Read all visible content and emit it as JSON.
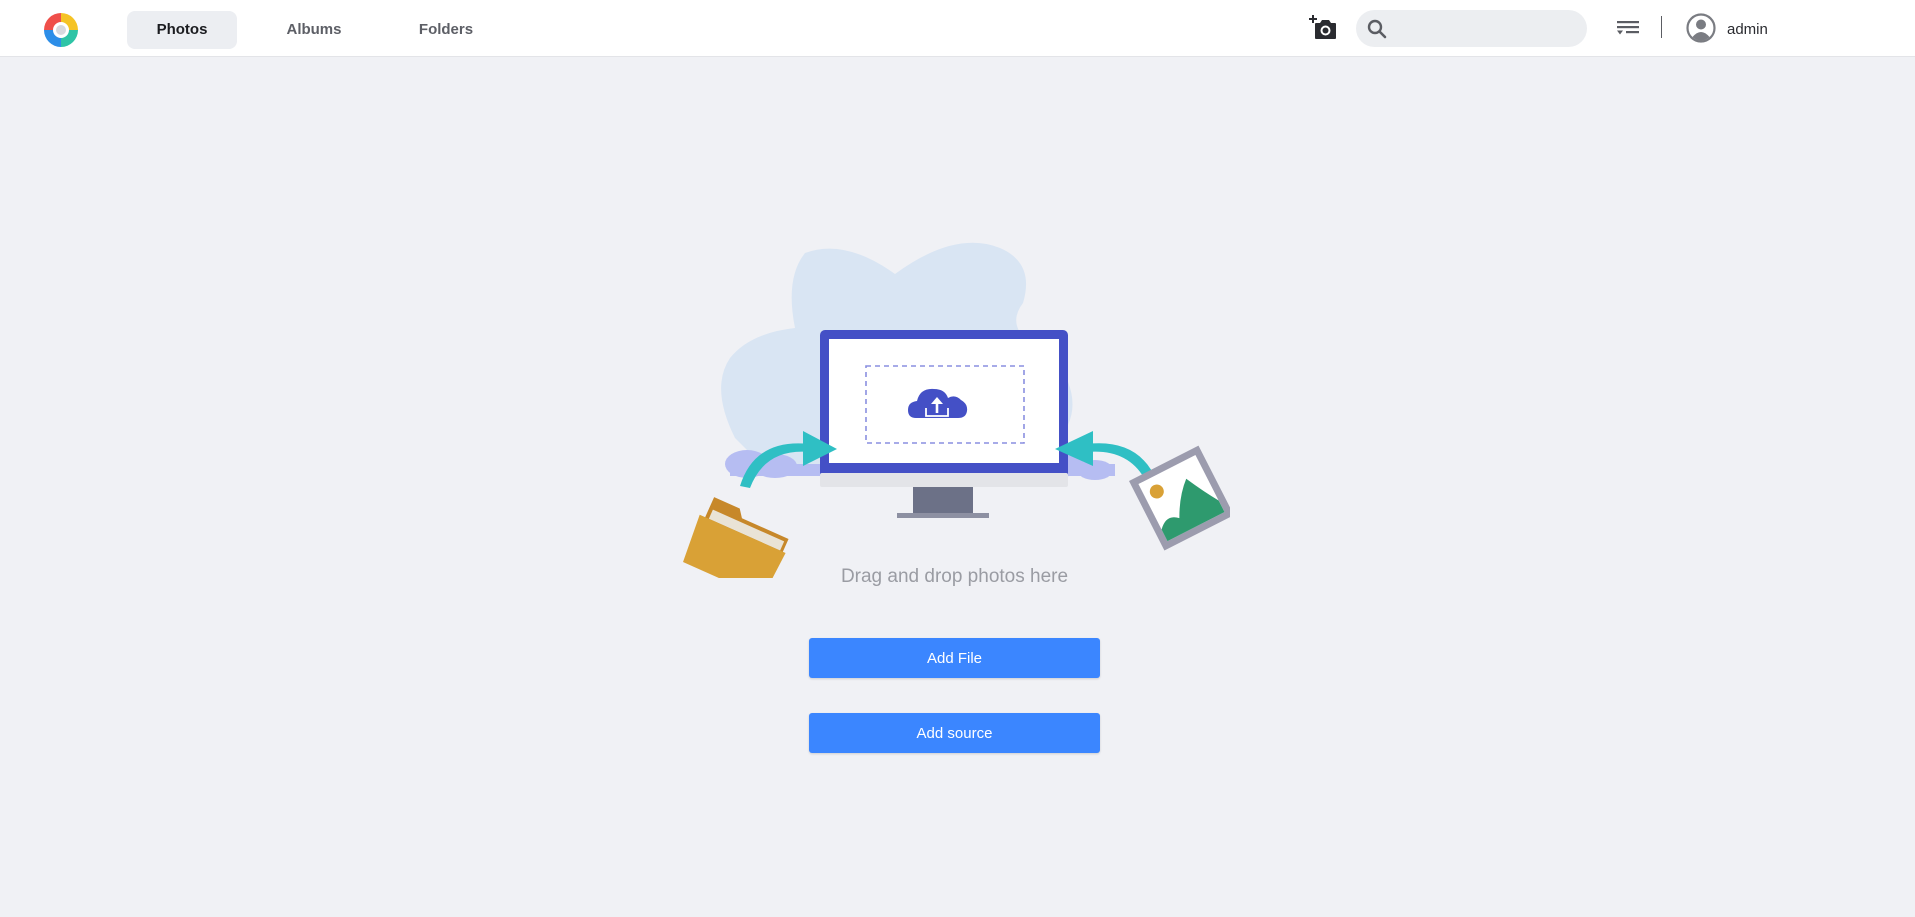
{
  "nav": {
    "tabs": [
      {
        "label": "Photos",
        "active": true
      },
      {
        "label": "Albums",
        "active": false
      },
      {
        "label": "Folders",
        "active": false
      }
    ]
  },
  "header": {
    "search_placeholder": "",
    "search_value": "",
    "username": "admin",
    "icons": [
      "app-logo-icon",
      "add-photo-camera-icon",
      "search-icon",
      "sort-filter-icon",
      "user-avatar-icon"
    ]
  },
  "main": {
    "drop_text": "Drag and drop photos here",
    "add_file_label": "Add File",
    "add_source_label": "Add source"
  },
  "colors": {
    "accent": "#3b86ff",
    "background": "#f0f1f5",
    "monitor": "#4450c6",
    "arrow": "#2fbfc4",
    "folder": "#d9a136",
    "landscape": "#2e9a6e"
  }
}
